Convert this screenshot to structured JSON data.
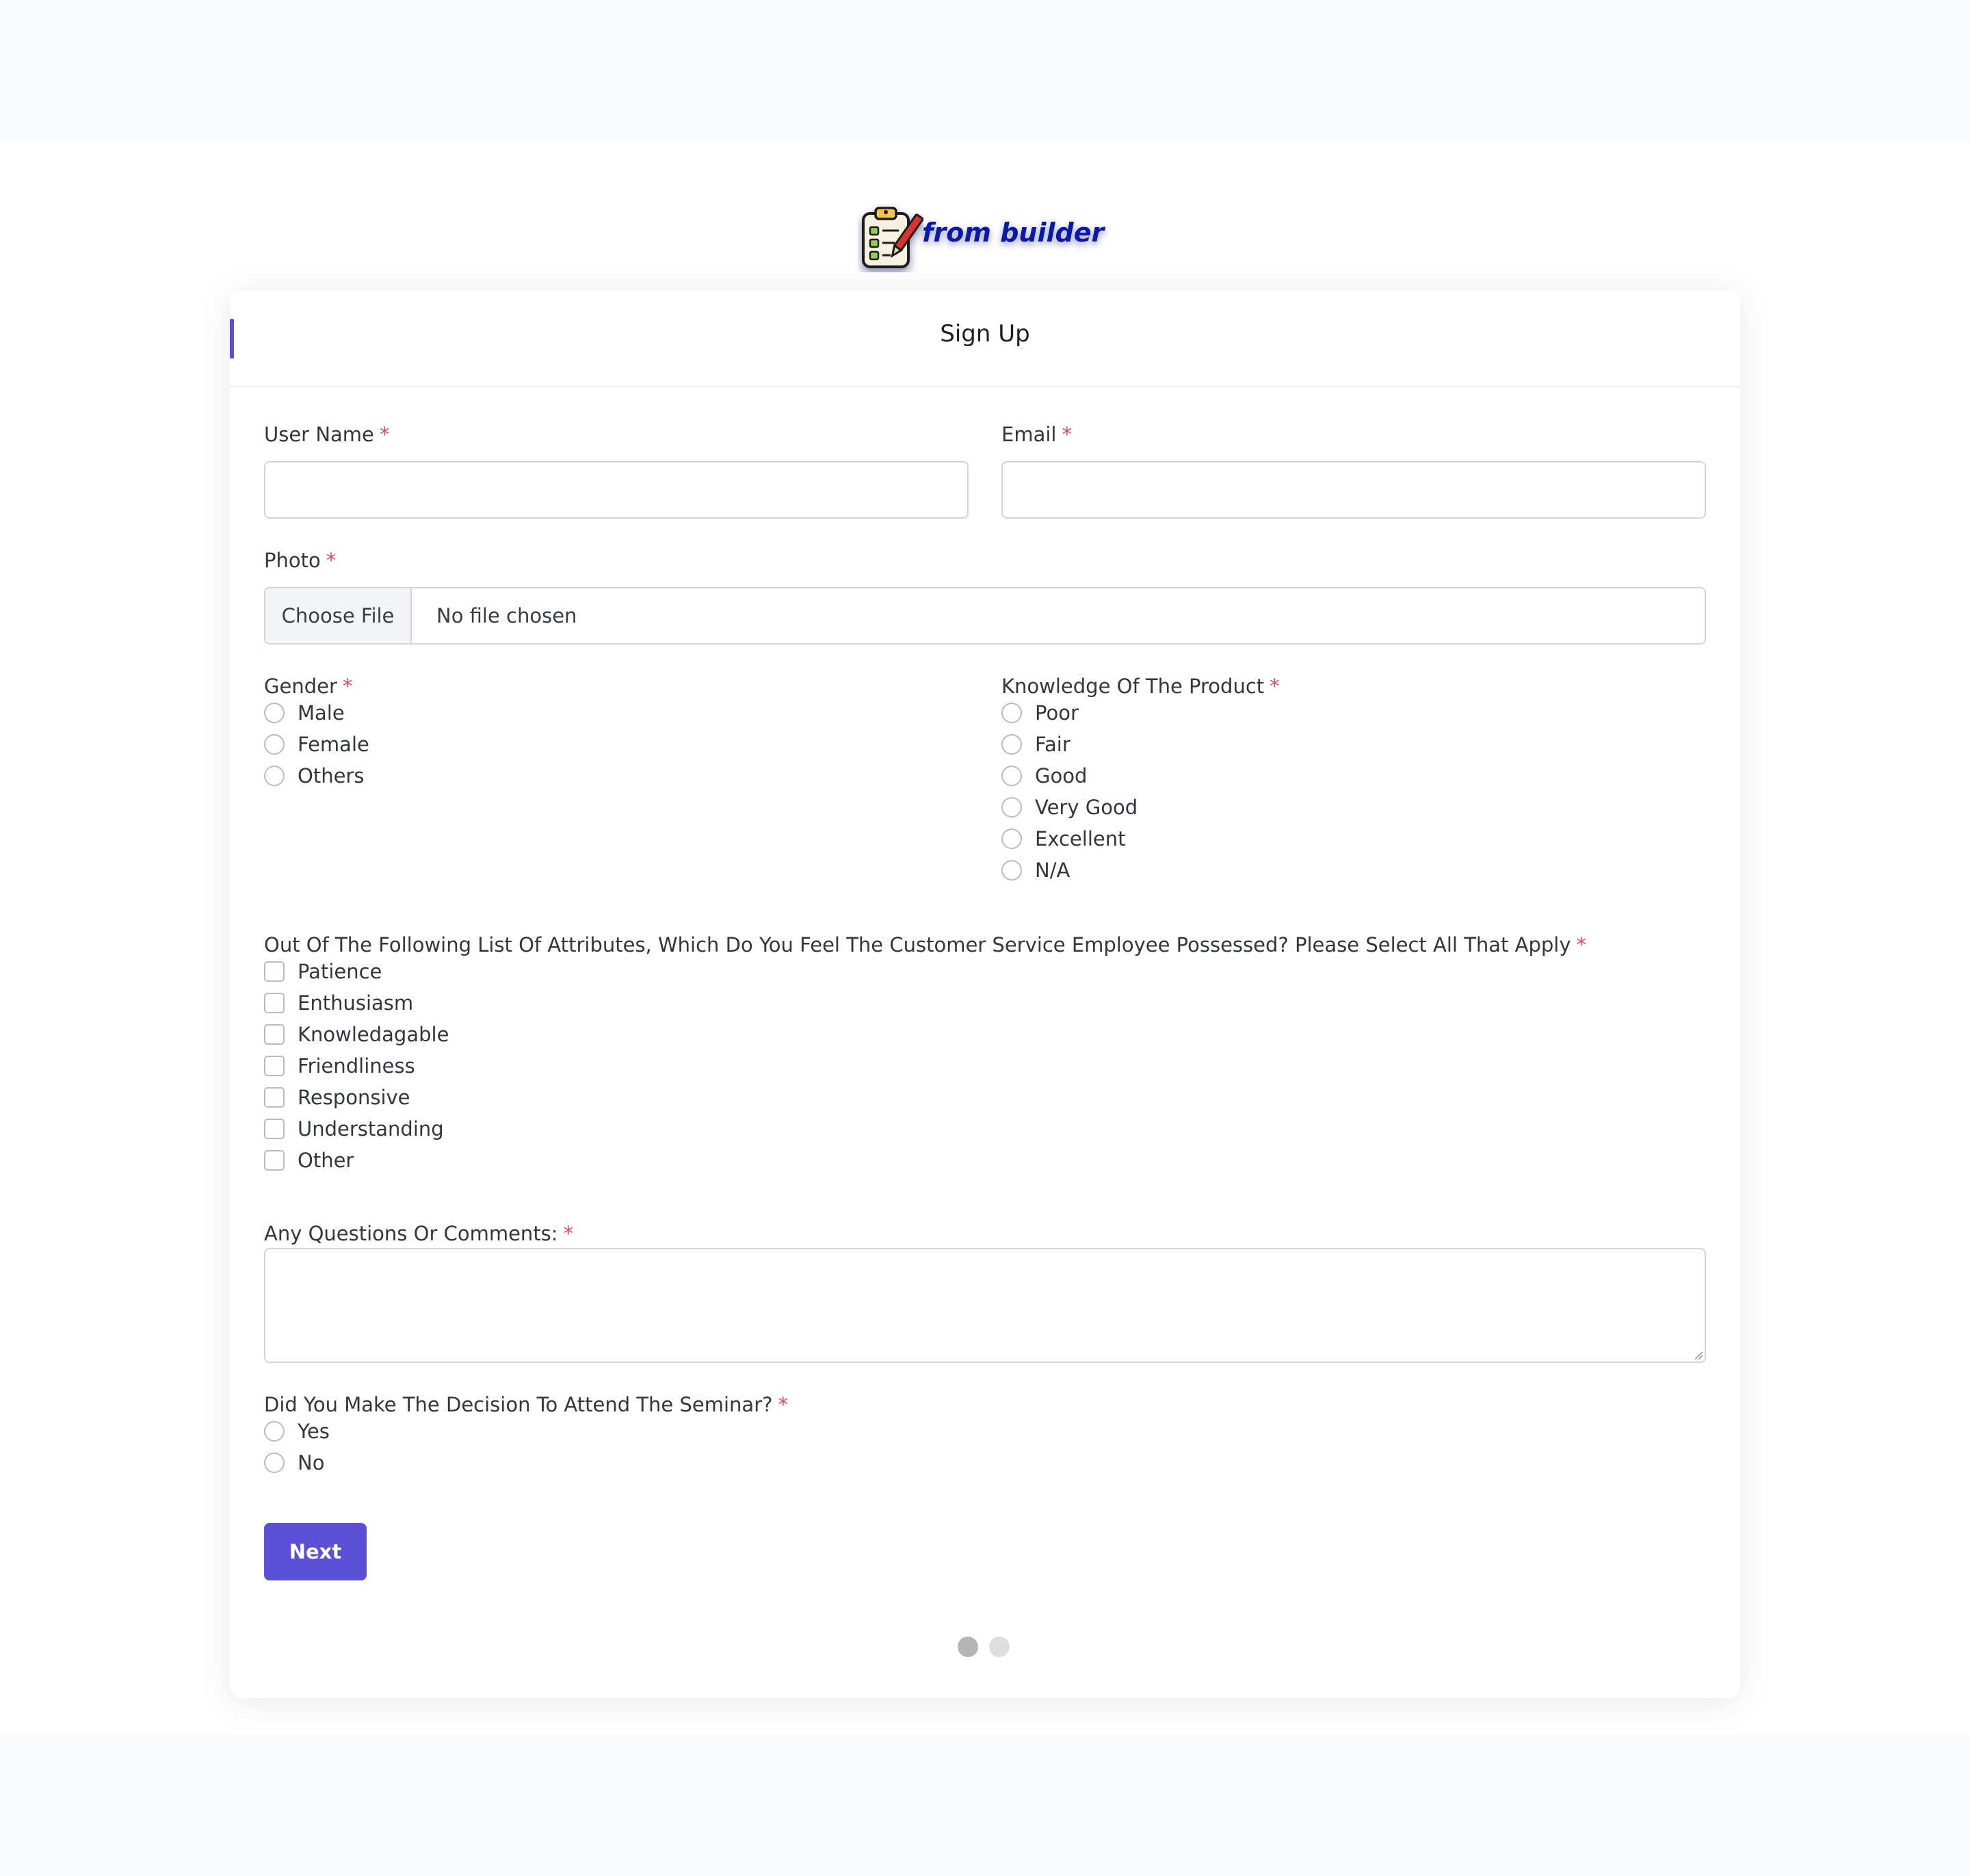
{
  "logo": {
    "text": "from builder"
  },
  "form": {
    "title": "Sign Up",
    "required_mark": "*",
    "username": {
      "label": "User Name",
      "value": "",
      "placeholder": ""
    },
    "email": {
      "label": "Email",
      "value": "",
      "placeholder": ""
    },
    "photo": {
      "label": "Photo",
      "button": "Choose File",
      "status": "No file chosen"
    },
    "gender": {
      "label": "Gender",
      "options": [
        "Male",
        "Female",
        "Others"
      ]
    },
    "knowledge": {
      "label": "Knowledge Of The Product",
      "options": [
        "Poor",
        "Fair",
        "Good",
        "Very Good",
        "Excellent",
        "N/A"
      ]
    },
    "attributes": {
      "label": "Out Of The Following List Of Attributes, Which Do You Feel The Customer Service Employee Possessed? Please Select All That Apply",
      "options": [
        "Patience",
        "Enthusiasm",
        "Knowledagable",
        "Friendliness",
        "Responsive",
        "Understanding",
        "Other"
      ]
    },
    "comments": {
      "label": "Any Questions Or Comments:",
      "value": ""
    },
    "seminar": {
      "label": "Did You Make The Decision To Attend The Seminar?",
      "options": [
        "Yes",
        "No"
      ]
    },
    "next_button": "Next",
    "pagination": {
      "current_step": 1,
      "total_steps": 2
    }
  },
  "colors": {
    "accent": "#5b4fd6",
    "required": "#e5456b",
    "page_bg": "#f9fafd",
    "logo_text": "#0a1aa6",
    "step_active": "#b5b5b8",
    "step_inactive": "#dedee1"
  }
}
